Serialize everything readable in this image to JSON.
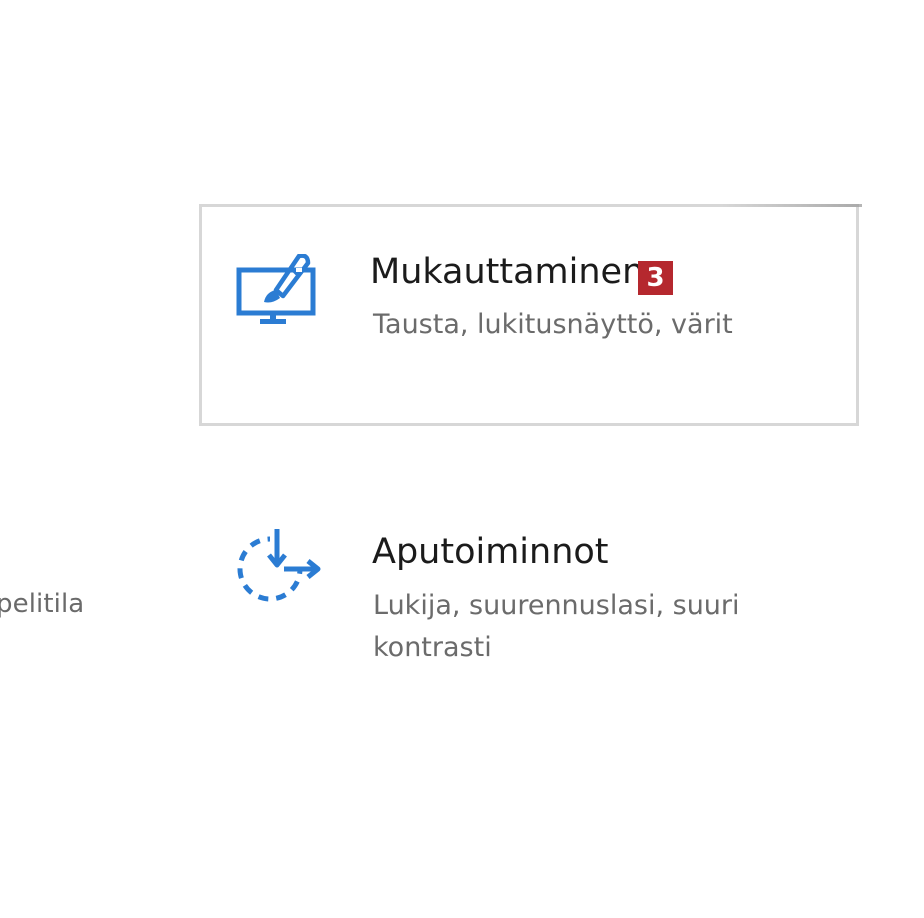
{
  "left_tile": {
    "description_fragment": "pelitila"
  },
  "tiles": [
    {
      "title": "Mukauttaminen",
      "description": "Tausta, lukitusnäyttö, värit",
      "icon": "personalization-icon",
      "badge": "3"
    },
    {
      "title": "Aputoiminnot",
      "description": "Lukija, suurennuslasi, suuri kontrasti",
      "icon": "ease-of-access-icon"
    }
  ],
  "colors": {
    "accent": "#2b7cd3",
    "badge": "#b5282e",
    "tile_border": "#d7d7d7",
    "title_text": "#1b1b1b",
    "desc_text": "#6b6b6b"
  }
}
